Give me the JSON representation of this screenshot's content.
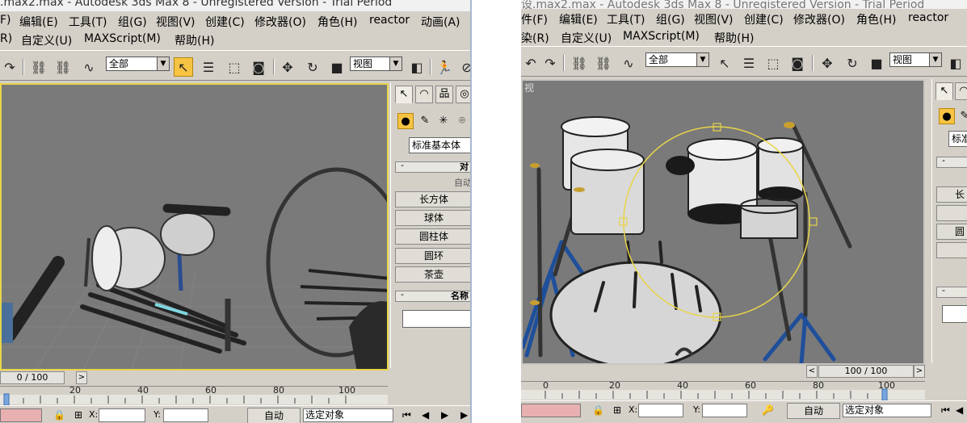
{
  "left": {
    "title": ".max2.max - Autodesk 3ds Max 8  - Unregistered Version - Trial Period",
    "menu_row1": [
      "F)",
      "编辑(E)",
      "工具(T)",
      "组(G)",
      "视图(V)",
      "创建(C)",
      "修改器(O)",
      "角色(H)",
      "reactor",
      "动画(A)"
    ],
    "menu_row2": [
      "R)",
      "自定义(U)",
      "MAXScript(M)",
      "帮助(H)"
    ],
    "selection_filter": "全部",
    "view_dropdown": "视图",
    "object_type_dropdown": "标准基本体",
    "rollout_object_type": "对",
    "auto_grid_label": "自动",
    "primitives": [
      "长方体",
      "球体",
      "圆柱体",
      "圆环",
      "茶壶"
    ],
    "rollout_name_color": "名称",
    "time_counter": "0 / 100",
    "time_scroll_left": "<",
    "time_scroll_right": ">",
    "track_ticks": [
      "0",
      "20",
      "40",
      "60",
      "80",
      "100"
    ],
    "x_label": "X:",
    "y_label": "Y:",
    "auto_key": "自动",
    "set_key_filter": "选定对象"
  },
  "right": {
    "title": "设.max2.max - Autodesk 3ds Max 8  - Unregistered Version - Trial Period",
    "menu_row1": [
      "件(F)",
      "编辑(E)",
      "工具(T)",
      "组(G)",
      "视图(V)",
      "创建(C)",
      "修改器(O)",
      "角色(H)",
      "reactor"
    ],
    "menu_row2": [
      "染(R)",
      "自定义(U)",
      "MAXScript(M)",
      "帮助(H)"
    ],
    "selection_filter": "全部",
    "view_dropdown": "视图",
    "viewport_label": "视",
    "object_type_dropdown": "标准",
    "primitives": [
      "长",
      "",
      "圆",
      ""
    ],
    "time_counter": "100 / 100",
    "time_scroll_left": "<",
    "time_scroll_right": ">",
    "track_ticks": [
      "0",
      "20",
      "40",
      "60",
      "80",
      "100"
    ],
    "x_label": "X:",
    "y_label": "Y:",
    "auto_key": "自动",
    "set_key_filter": "选定对象"
  },
  "colors": {
    "ui_gray": "#d4d0c8",
    "viewport_gray": "#7a7a7a",
    "active_viewport_border": "#e8d44a",
    "active_tool": "#f6c343",
    "gizmo_yellow": "#e8d44a",
    "stand_blue": "#1f4f9a",
    "timeline_marker": "#7aa6e0"
  }
}
